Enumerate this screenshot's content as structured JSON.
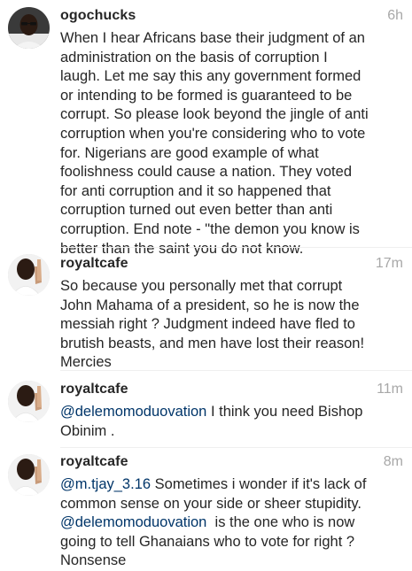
{
  "comments": [
    {
      "username": "ogochucks",
      "time": "6h",
      "avatar_icon": "profile-photo-man-with-glasses",
      "lines": [
        [
          "When I hear Africans base their judgment of an"
        ],
        [
          "administration on the basis of corruption I"
        ],
        [
          "laugh. Let me say this any government formed"
        ],
        [
          "or intending to be formed is guaranteed to be"
        ],
        [
          "corrupt. So please look beyond the jingle of anti"
        ],
        [
          "corruption when you're considering who to vote"
        ],
        [
          "for. Nigerians are good example of what"
        ],
        [
          "foolishness could cause a nation. They voted"
        ],
        [
          "for anti corruption and it so happened that"
        ],
        [
          "corruption turned out even better than anti"
        ],
        [
          "corruption. End note - \"the demon you know is"
        ],
        [
          "better than the saint you do not know."
        ]
      ]
    },
    {
      "username": "royaltcafe",
      "time": "17m",
      "avatar_icon": "profile-photo-praying-hands",
      "lines": [
        [
          "So because you personally met that corrupt"
        ],
        [
          "John Mahama of a president, so he is now the"
        ],
        [
          "messiah right ? Judgment indeed have fled to"
        ],
        [
          "brutish beasts, and men have lost their reason!"
        ],
        [
          "Mercies"
        ]
      ]
    },
    {
      "username": "royaltcafe",
      "time": "11m",
      "avatar_icon": "profile-photo-praying-hands",
      "mention": "@delemomoduovation",
      "lines_rest": [
        " I think you need Bishop",
        "Obinim ."
      ]
    },
    {
      "username": "royaltcafe",
      "time": "8m",
      "avatar_icon": "profile-photo-praying-hands",
      "mention1": "@m.tjay_3.16",
      "line1_rest": " Sometimes i wonder if it's lack of",
      "line2": "common sense on your side or sheer stupidity.",
      "mention2": "@delemomoduovation",
      "line3_rest": "  is the one who is now",
      "line4": "going to tell Ghanaians who to vote for right ?",
      "line5": "Nonsense"
    }
  ]
}
